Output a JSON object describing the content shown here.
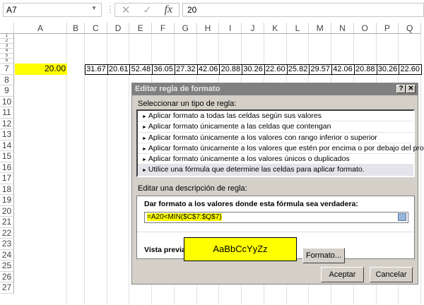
{
  "formula_bar": {
    "name_box": "A7",
    "cancel_icon": "✕",
    "enter_icon": "✓",
    "fx": "fx",
    "value": "20"
  },
  "columns": [
    "A",
    "B",
    "C",
    "D",
    "E",
    "F",
    "G",
    "H",
    "I",
    "J",
    "K",
    "L",
    "M",
    "N",
    "O",
    "P",
    "Q"
  ],
  "rows_top": [
    "1",
    "2",
    "3",
    "4",
    "5",
    "6"
  ],
  "rows": [
    "7",
    "8",
    "9",
    "10",
    "11",
    "12",
    "13",
    "14",
    "15",
    "16",
    "17",
    "18",
    "19",
    "20",
    "21",
    "22",
    "23",
    "24",
    "25",
    "26",
    "27"
  ],
  "a7": "20.00",
  "row7_values": [
    "31.67",
    "20.61",
    "52.48",
    "36.05",
    "27.32",
    "42.06",
    "20.88",
    "30.26",
    "22.60",
    "25.82",
    "29.57",
    "42.06",
    "20.88",
    "30.26",
    "22.60"
  ],
  "colors": {
    "highlight": "#ffff00",
    "dialog": "#d4d0c8",
    "title": "#808080"
  },
  "dialog": {
    "title": "Editar regla de formato",
    "help": "?",
    "close": "✕",
    "select_label": "Seleccionar un tipo de regla:",
    "rule_types": [
      "Aplicar formato a todas las celdas según sus valores",
      "Aplicar formato únicamente a las celdas que contengan",
      "Aplicar formato únicamente a los valores con rango inferior o superior",
      "Aplicar formato únicamente a los valores que estén por encima o por debajo del promedio",
      "Aplicar formato únicamente a los valores únicos o duplicados",
      "Utilice una fórmula que determine las celdas para aplicar formato."
    ],
    "edit_label": "Editar una descripción de regla:",
    "formula_label": "Dar formato a los valores donde esta fórmula sea verdadera:",
    "formula": "=A20<MIN($C$7:$Q$7)",
    "preview_label": "Vista previa:",
    "preview_text": "AaBbCcYyZz",
    "format_button": "Formato...",
    "ok_button": "Aceptar",
    "cancel_button": "Cancelar"
  }
}
